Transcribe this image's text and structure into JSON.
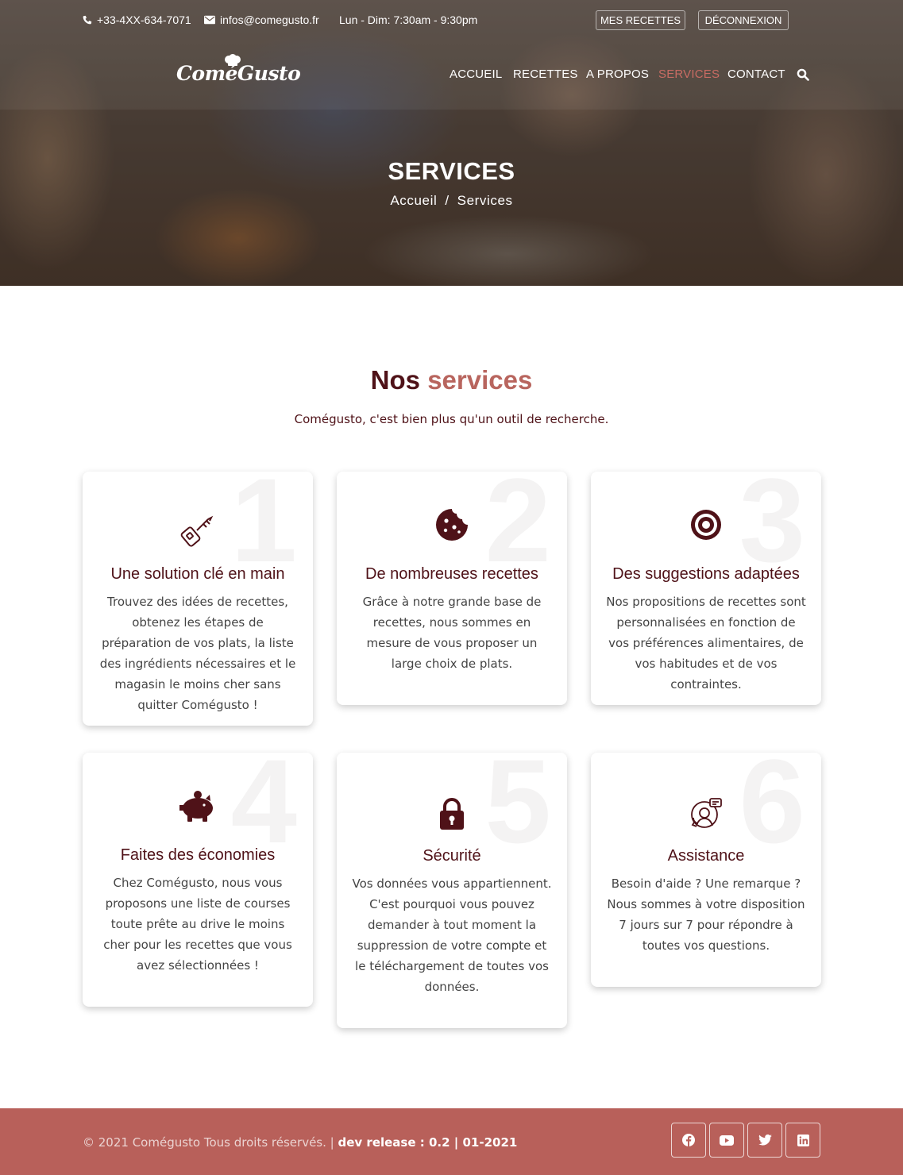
{
  "topbar": {
    "phone": "+33-4XX-634-7071",
    "email": "infos@comegusto.fr",
    "hours": "Lun - Dim: 7:30am - 9:30pm",
    "my_recipes_label": "MES RECETTES",
    "logout_label": "DÉCONNEXION"
  },
  "brand": {
    "logo_text": "ComéGusto"
  },
  "nav": {
    "items": [
      {
        "label": "ACCUEIL"
      },
      {
        "label": "RECETTES"
      },
      {
        "label": "A PROPOS"
      },
      {
        "label": "SERVICES",
        "active": true
      },
      {
        "label": "CONTACT"
      }
    ],
    "search_icon": "search-icon"
  },
  "hero": {
    "title": "SERVICES",
    "breadcrumb": [
      "Accueil",
      "Services"
    ],
    "separator": "/"
  },
  "section": {
    "title_main": "Nos",
    "title_accent": "services",
    "subtitle": "Comégusto, c'est bien plus qu'un outil de recherche."
  },
  "services": [
    {
      "number": "1",
      "icon": "key-icon",
      "title": "Une solution clé en main",
      "text": "Trouvez des idées de recettes, obtenez les étapes de préparation de vos plats, la liste des ingrédients nécessaires et le magasin le moins cher sans quitter Comégusto !"
    },
    {
      "number": "2",
      "icon": "cookie-icon",
      "title": "De nombreuses recettes",
      "text": "Grâce à notre grande base de recettes, nous sommes en mesure de vous proposer un large choix de plats."
    },
    {
      "number": "3",
      "icon": "target-icon",
      "title": "Des suggestions adaptées",
      "text": "Nos propositions de recettes sont personnalisées en fonction de vos préférences alimentaires, de vos habitudes et de vos contraintes."
    },
    {
      "number": "4",
      "icon": "piggy-bank-icon",
      "title": "Faites des économies",
      "text": "Chez Comégusto, nous vous proposons une liste de courses toute prête au drive le moins cher pour les recettes que vous avez sélectionnées !"
    },
    {
      "number": "5",
      "icon": "lock-icon",
      "title": "Sécurité",
      "text": "Vos données vous appartiennent. C'est pourquoi vous pouvez demander à tout moment la suppression de votre compte et le téléchargement de toutes vos données."
    },
    {
      "number": "6",
      "icon": "support-icon",
      "title": "Assistance",
      "text": "Besoin d'aide ? Une remarque ? Nous sommes à votre disposition 7 jours sur 7 pour répondre à toutes vos questions."
    }
  ],
  "footer": {
    "copyright": "© 2021 Comégusto Tous droits réservés.",
    "divider": "|",
    "release": "dev release : 0.2 | 01-2021",
    "socials": [
      "facebook-icon",
      "youtube-icon",
      "twitter-icon",
      "linkedin-icon"
    ]
  },
  "colors": {
    "brand_dark": "#4f1218",
    "accent": "#b8655e",
    "footer_bg": "#b8605a",
    "nav_active": "#c86b63"
  }
}
